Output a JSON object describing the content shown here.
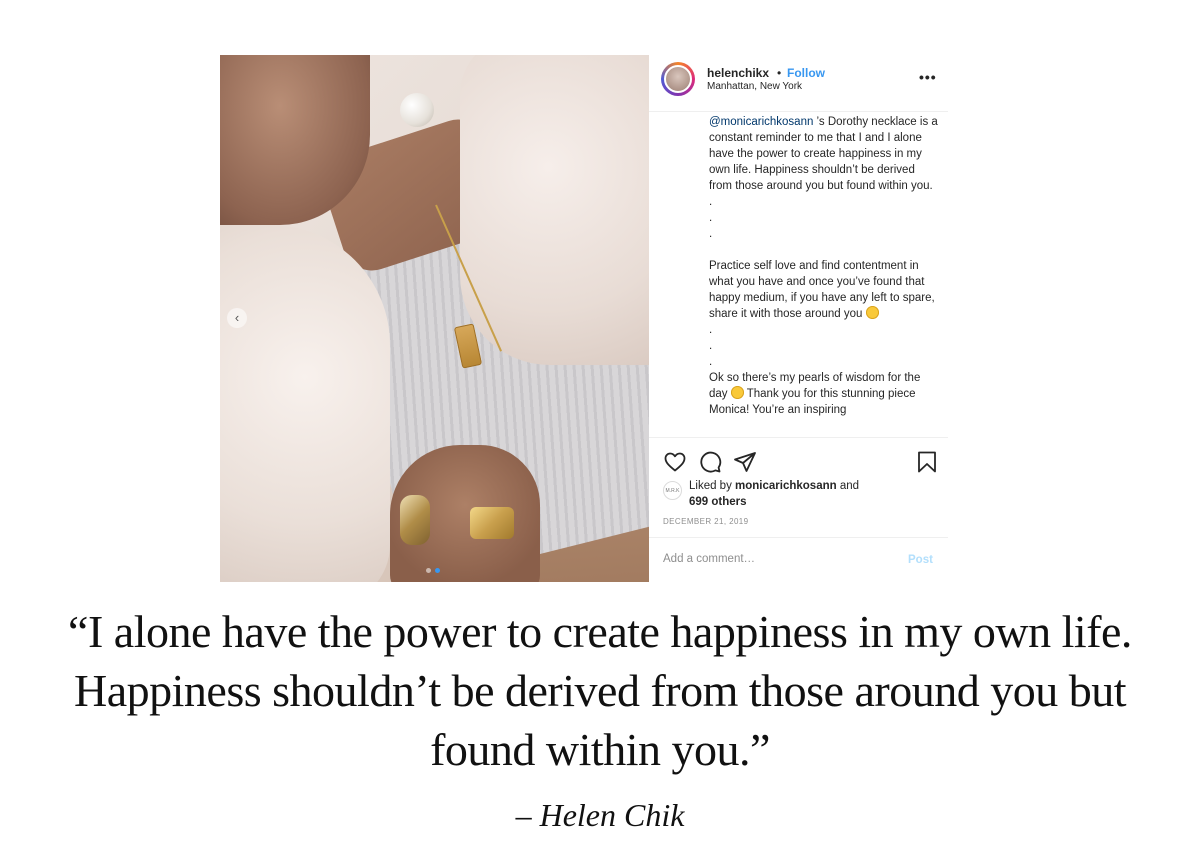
{
  "post": {
    "username": "helenchikx",
    "separator": "•",
    "follow_label": "Follow",
    "location": "Manhattan, New York",
    "more_label": "•••",
    "carousel": {
      "count": 2,
      "active_index": 1
    },
    "caption": {
      "mention": "@monicarichkosann",
      "para1_rest": " ’s Dorothy necklace is a constant reminder to me that I and I alone have the power to create happiness in my own life. Happiness shouldn’t be derived from those around you but found within you.",
      "dots1": [
        ".",
        ".",
        "."
      ],
      "para2": "Practice self love and find contentment in what you have and once you’ve found that happy medium, if you have any left to spare, share it with those around you",
      "dots2": [
        ".",
        ".",
        "."
      ],
      "para3_a": "Ok so there’s my pearls of wisdom for the day",
      "para3_b": " Thank you for this stunning piece Monica! You’re an inspiring"
    },
    "icons": [
      "heart-icon",
      "comment-icon",
      "share-icon",
      "bookmark-icon"
    ],
    "likes": {
      "avatar_text": "M.R.K",
      "prefix": "Liked by ",
      "liker": "monicarichkosann",
      "middle": " and",
      "others": "699 others"
    },
    "date": "DECEMBER 21, 2019",
    "comment_placeholder": "Add a comment…",
    "post_label": "Post",
    "colors": {
      "link_blue": "#3897f0",
      "mention": "#00376b",
      "post_disabled": "#b2dffc"
    }
  },
  "quote": {
    "text": "“I alone have the power to create happiness in my own life. Happiness shouldn’t be derived from those around you but found within you.”",
    "attribution": "– Helen Chik"
  }
}
